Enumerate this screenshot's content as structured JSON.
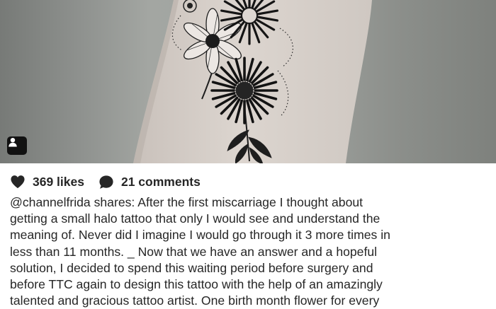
{
  "post": {
    "likes": "369 likes",
    "comments": "21 comments",
    "caption_lines": [
      "@channelfrida shares: After the first miscarriage I thought about",
      "getting a small halo tattoo that only I would see and understand the",
      "meaning of. Never did I imagine I would go through it 3 more times in",
      "less than 11 months. _ Now that we have an answer and a hopeful",
      "solution, I decided to spend this waiting period before surgery and",
      "before TTC again to design this tattoo with the help of an amazingly",
      "talented and gracious tattoo artist. One birth month flower for every"
    ]
  },
  "icons": {
    "likes": "heart-icon",
    "comments": "comment-bubble-icon",
    "tag": "person-tag-icon"
  },
  "colors": {
    "text": "#262626",
    "photo_background": "#9a9d99",
    "skin": "#d6cfc9",
    "ink": "#1c1c1c"
  }
}
